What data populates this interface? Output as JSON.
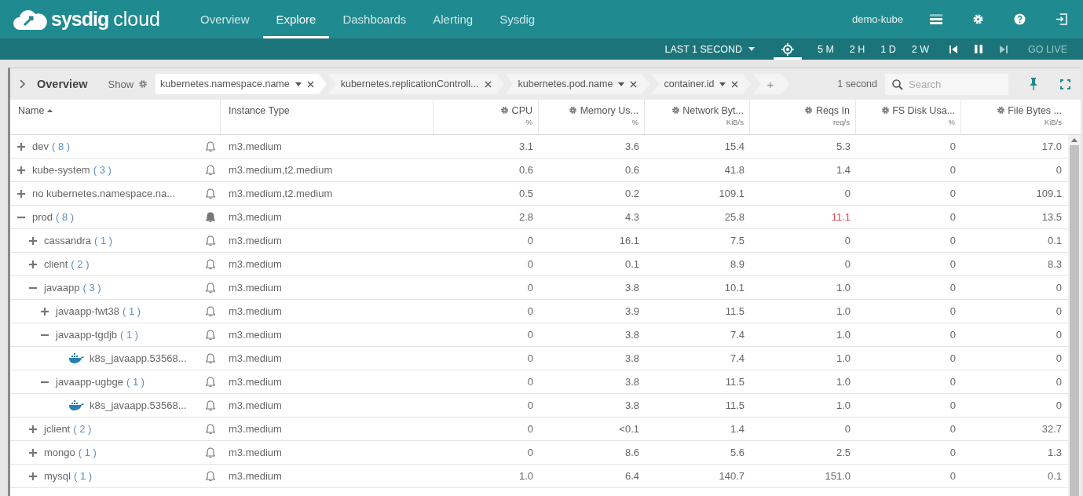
{
  "brand": {
    "name": "sysdig",
    "suffix": "cloud"
  },
  "nav": [
    {
      "label": "Overview",
      "selected": false
    },
    {
      "label": "Explore",
      "selected": true
    },
    {
      "label": "Dashboards",
      "selected": false
    },
    {
      "label": "Alerting",
      "selected": false
    },
    {
      "label": "Sysdig",
      "selected": false
    }
  ],
  "user": "demo-kube",
  "timebar": {
    "range": "LAST 1 SECOND",
    "presets": [
      {
        "label": "5 M",
        "selected": false
      },
      {
        "label": "2 H",
        "selected": false
      },
      {
        "label": "1 D",
        "selected": false
      },
      {
        "label": "2 W",
        "selected": false
      }
    ],
    "go_live": "GO LIVE"
  },
  "panel": {
    "title": "Overview",
    "show_label": "Show",
    "groupings": [
      {
        "label": "kubernetes.namespace.name",
        "has_menu": true
      },
      {
        "label": "kubernetes.replicationControll...",
        "has_menu": false
      },
      {
        "label": "kubernetes.pod.name",
        "has_menu": true
      },
      {
        "label": "container.id",
        "has_menu": true
      }
    ],
    "add": "+",
    "interval": "1 second",
    "search": {
      "placeholder": "Search"
    }
  },
  "table": {
    "columns": [
      {
        "label": "Name",
        "kind": "name"
      },
      {
        "label": "Instance Type",
        "kind": "text"
      },
      {
        "label": "CPU",
        "unit": "%",
        "kind": "metric"
      },
      {
        "label": "Memory Us...",
        "unit": "%",
        "kind": "metric"
      },
      {
        "label": "Network Byt...",
        "unit": "KiB/s",
        "kind": "metric"
      },
      {
        "label": "Reqs In",
        "unit": "req/s",
        "kind": "metric"
      },
      {
        "label": "FS Disk Usa...",
        "unit": "%",
        "kind": "metric"
      },
      {
        "label": "File Bytes ...",
        "unit": "KiB/s",
        "kind": "metric"
      }
    ],
    "rows": [
      {
        "kind": "group",
        "name": "dev",
        "count": "( 8 )",
        "expanded": false,
        "alert_set": false,
        "instance": "m3.medium",
        "values": [
          "3.1",
          "3.6",
          "15.4",
          "5.3",
          "0",
          "17.0"
        ],
        "reqs_alert": false
      },
      {
        "kind": "group",
        "name": "kube-system",
        "count": "( 3 )",
        "expanded": false,
        "alert_set": false,
        "instance": "m3.medium,t2.medium",
        "values": [
          "0.6",
          "0.6",
          "41.8",
          "1.4",
          "0",
          "0"
        ],
        "reqs_alert": false
      },
      {
        "kind": "group",
        "name": "no kubernetes.namespace.na...",
        "expanded": false,
        "alert_set": false,
        "instance": "m3.medium,t2.medium",
        "values": [
          "0.5",
          "0.2",
          "109.1",
          "0",
          "0",
          "109.1"
        ],
        "reqs_alert": false
      },
      {
        "kind": "group",
        "name": "prod",
        "count": "( 8 )",
        "expanded": true,
        "alert_set": true,
        "instance": "m3.medium",
        "values": [
          "2.8",
          "4.3",
          "25.8",
          "11.1",
          "0",
          "13.5"
        ],
        "reqs_alert": true,
        "children": [
          {
            "kind": "group",
            "name": "cassandra",
            "count": "( 1 )",
            "expanded": false,
            "alert_set": false,
            "instance": "m3.medium",
            "values": [
              "0",
              "16.1",
              "7.5",
              "0",
              "0",
              "0.1"
            ],
            "reqs_alert": false
          },
          {
            "kind": "group",
            "name": "client",
            "count": "( 2 )",
            "expanded": false,
            "alert_set": false,
            "instance": "m3.medium",
            "values": [
              "0",
              "0.1",
              "8.9",
              "0",
              "0",
              "8.3"
            ],
            "reqs_alert": false
          },
          {
            "kind": "group",
            "name": "javaapp",
            "count": "( 3 )",
            "expanded": true,
            "alert_set": false,
            "instance": "m3.medium",
            "values": [
              "0",
              "3.8",
              "10.1",
              "1.0",
              "0",
              "0"
            ],
            "reqs_alert": false,
            "children": [
              {
                "kind": "group",
                "name": "javaapp-fwt38",
                "count": "( 1 )",
                "expanded": false,
                "alert_set": false,
                "instance": "m3.medium",
                "values": [
                  "0",
                  "3.9",
                  "11.5",
                  "1.0",
                  "0",
                  "0"
                ],
                "reqs_alert": false
              },
              {
                "kind": "group",
                "name": "javaapp-tgdjb",
                "count": "( 1 )",
                "expanded": true,
                "alert_set": false,
                "instance": "m3.medium",
                "values": [
                  "0",
                  "3.8",
                  "7.4",
                  "1.0",
                  "0",
                  "0"
                ],
                "reqs_alert": false,
                "children": [
                  {
                    "kind": "container",
                    "name": "k8s_javaapp.53568...",
                    "alert_set": false,
                    "instance": "m3.medium",
                    "values": [
                      "0",
                      "3.8",
                      "7.4",
                      "1.0",
                      "0",
                      "0"
                    ],
                    "reqs_alert": false
                  }
                ]
              },
              {
                "kind": "group",
                "name": "javaapp-ugbge",
                "count": "( 1 )",
                "expanded": true,
                "alert_set": false,
                "instance": "m3.medium",
                "values": [
                  "0",
                  "3.8",
                  "11.5",
                  "1.0",
                  "0",
                  "0"
                ],
                "reqs_alert": false,
                "children": [
                  {
                    "kind": "container",
                    "name": "k8s_javaapp.53568...",
                    "alert_set": false,
                    "instance": "m3.medium",
                    "values": [
                      "0",
                      "3.8",
                      "11.5",
                      "1.0",
                      "0",
                      "0"
                    ],
                    "reqs_alert": false
                  }
                ]
              }
            ]
          },
          {
            "kind": "group",
            "name": "jclient",
            "count": "( 2 )",
            "expanded": false,
            "alert_set": false,
            "instance": "m3.medium",
            "values": [
              "0",
              "<0.1",
              "1.4",
              "0",
              "0",
              "32.7"
            ],
            "reqs_alert": false
          },
          {
            "kind": "group",
            "name": "mongo",
            "count": "( 1 )",
            "expanded": false,
            "alert_set": false,
            "instance": "m3.medium",
            "values": [
              "0",
              "8.6",
              "5.6",
              "2.5",
              "0",
              "1.3"
            ],
            "reqs_alert": false
          },
          {
            "kind": "group",
            "name": "mysql",
            "count": "( 1 )",
            "expanded": false,
            "alert_set": false,
            "instance": "m3.medium",
            "values": [
              "1.0",
              "6.4",
              "140.7",
              "151.0",
              "0",
              "0.1"
            ],
            "reqs_alert": false
          }
        ]
      }
    ]
  }
}
